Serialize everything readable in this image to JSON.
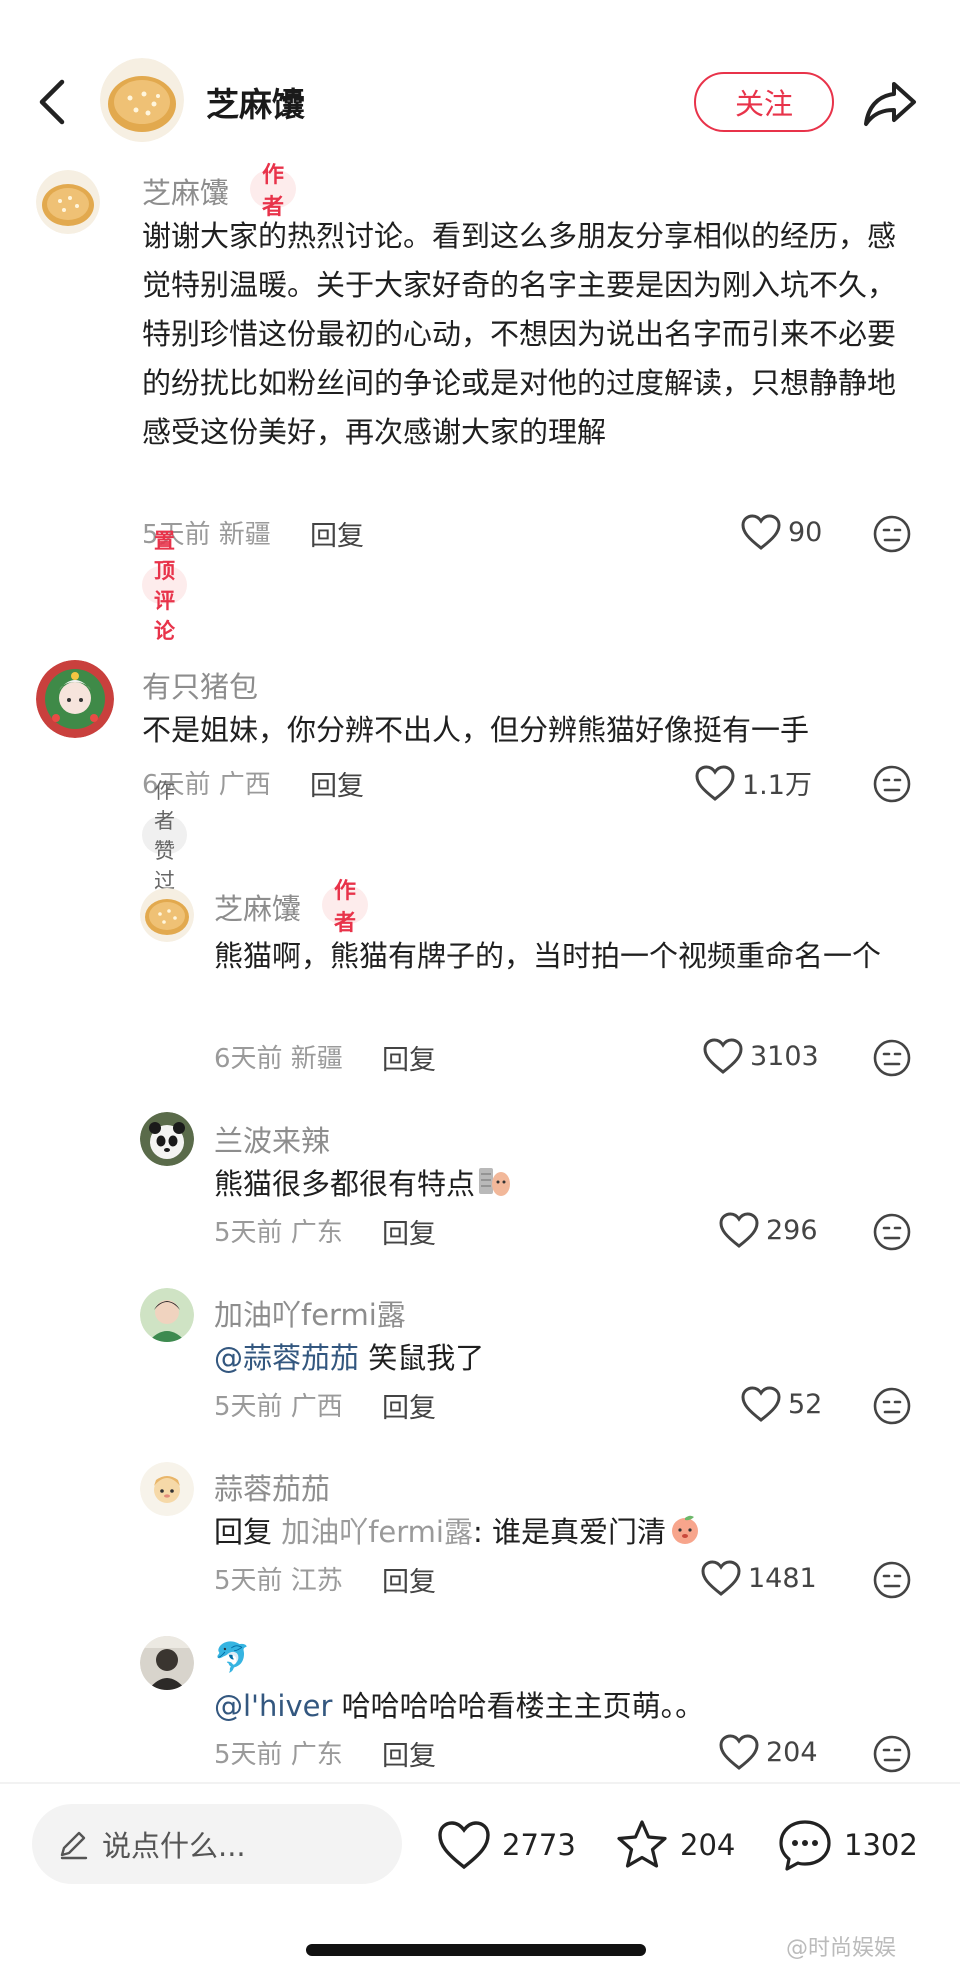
{
  "header": {
    "author_name": "芝麻馕",
    "follow_label": "关注"
  },
  "comments": [
    {
      "name": "芝麻馕",
      "tag": "作者",
      "text": "谢谢大家的热烈讨论。看到这么多朋友分享相似的经历，感觉特别温暖。关于大家好奇的名字主要是因为刚入坑不久，特别珍惜这份最初的心动，不想因为说出名字而引来不必要的纷扰比如粉丝间的争论或是对他的过度解读，只想静静地感受这份美好，再次感谢大家的理解",
      "meta": "5天前 新疆",
      "reply": "回复",
      "likes": "90",
      "badge": "置顶评论"
    },
    {
      "name": "有只猪包",
      "text": "不是姐妹，你分辨不出人，但分辨熊猫好像挺有一手",
      "meta": "6天前 广西",
      "reply": "回复",
      "likes": "1.1万",
      "badge": "作者赞过"
    }
  ],
  "replies": [
    {
      "name": "芝麻馕",
      "tag": "作者",
      "text": "熊猫啊，熊猫有牌子的，当时拍一个视频重命名一个",
      "meta": "6天前 新疆",
      "reply": "回复",
      "likes": "3103"
    },
    {
      "name": "兰波来辣",
      "text": "熊猫很多都很有特点",
      "meta": "5天前 广东",
      "reply": "回复",
      "likes": "296"
    },
    {
      "name": "加油吖fermi露",
      "mention": "@蒜蓉茄茄",
      "text": " 笑鼠我了",
      "meta": "5天前 广西",
      "reply": "回复",
      "likes": "52"
    },
    {
      "name": "蒜蓉茄茄",
      "prefix": "回复 ",
      "reply_to": "加油吖fermi露",
      "text": ": 谁是真爱门清",
      "meta": "5天前 江苏",
      "reply": "回复",
      "likes": "1481"
    },
    {
      "name": "🐬",
      "mention": "@l'hiver",
      "text": " 哈哈哈哈哈看楼主主页萌。。",
      "meta": "5天前 广东",
      "reply": "回复",
      "likes": "204"
    }
  ],
  "bottom_bar": {
    "input_placeholder": "说点什么...",
    "like_count": "2773",
    "collect_count": "204",
    "comment_count": "1302"
  },
  "watermark": "@时尚娱娱",
  "colors": {
    "accent": "#e8334a",
    "mention": "#33577f",
    "meta": "#9a9a9a"
  }
}
